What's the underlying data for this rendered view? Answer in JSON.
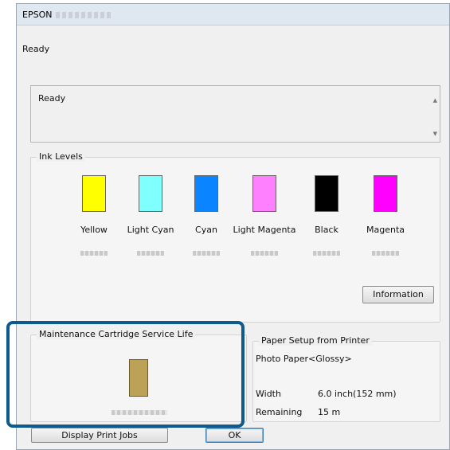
{
  "window": {
    "title_brand": "EPSON",
    "status": "Ready",
    "message": "Ready"
  },
  "ink_levels": {
    "label": "Ink Levels",
    "inks": [
      {
        "name": "Yellow",
        "color": "#ffff00"
      },
      {
        "name": "Light Cyan",
        "color": "#80ffff"
      },
      {
        "name": "Cyan",
        "color": "#0a84ff"
      },
      {
        "name": "Light Magenta",
        "color": "#ff80ff"
      },
      {
        "name": "Black",
        "color": "#000000"
      },
      {
        "name": "Magenta",
        "color": "#ff00ff"
      }
    ],
    "information_button": "Information"
  },
  "maintenance": {
    "label": "Maintenance Cartridge Service Life",
    "color": "#bca257"
  },
  "paper_setup": {
    "label": "Paper Setup from Printer",
    "paper_type": "Photo Paper<Glossy>",
    "rows": [
      {
        "key": "Width",
        "value": "6.0 inch(152 mm)"
      },
      {
        "key": "Remaining",
        "value": "15 m"
      }
    ]
  },
  "buttons": {
    "display_print_jobs": "Display Print Jobs",
    "ok": "OK"
  }
}
